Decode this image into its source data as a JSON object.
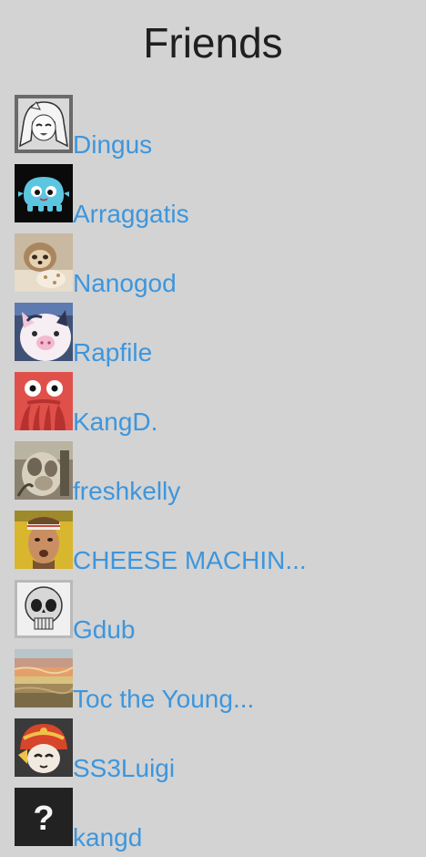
{
  "page": {
    "title": "Friends"
  },
  "friends": [
    {
      "name": "Dingus",
      "avatar_icon": "anime-girl-avatar-icon"
    },
    {
      "name": "Arraggatis",
      "avatar_icon": "blue-monster-avatar-icon"
    },
    {
      "name": "Nanogod",
      "avatar_icon": "sloth-avatar-icon"
    },
    {
      "name": "Rapfile",
      "avatar_icon": "cartoon-pig-avatar-icon"
    },
    {
      "name": "KangD.",
      "avatar_icon": "red-octopus-alien-avatar-icon"
    },
    {
      "name": "freshkelly",
      "avatar_icon": "blurry-creature-avatar-icon"
    },
    {
      "name": "CHEESE MACHIN...",
      "avatar_icon": "man-headband-avatar-icon"
    },
    {
      "name": "Gdub",
      "avatar_icon": "skull-avatar-icon"
    },
    {
      "name": "Toc the Young...",
      "avatar_icon": "sunset-landscape-avatar-icon"
    },
    {
      "name": "SS3Luigi",
      "avatar_icon": "helmet-character-avatar-icon"
    },
    {
      "name": "kangd",
      "avatar_icon": "question-mark-avatar-icon"
    }
  ],
  "colors": {
    "background": "#d3d3d3",
    "link": "#3d96dd",
    "title": "#1f1f1f"
  }
}
